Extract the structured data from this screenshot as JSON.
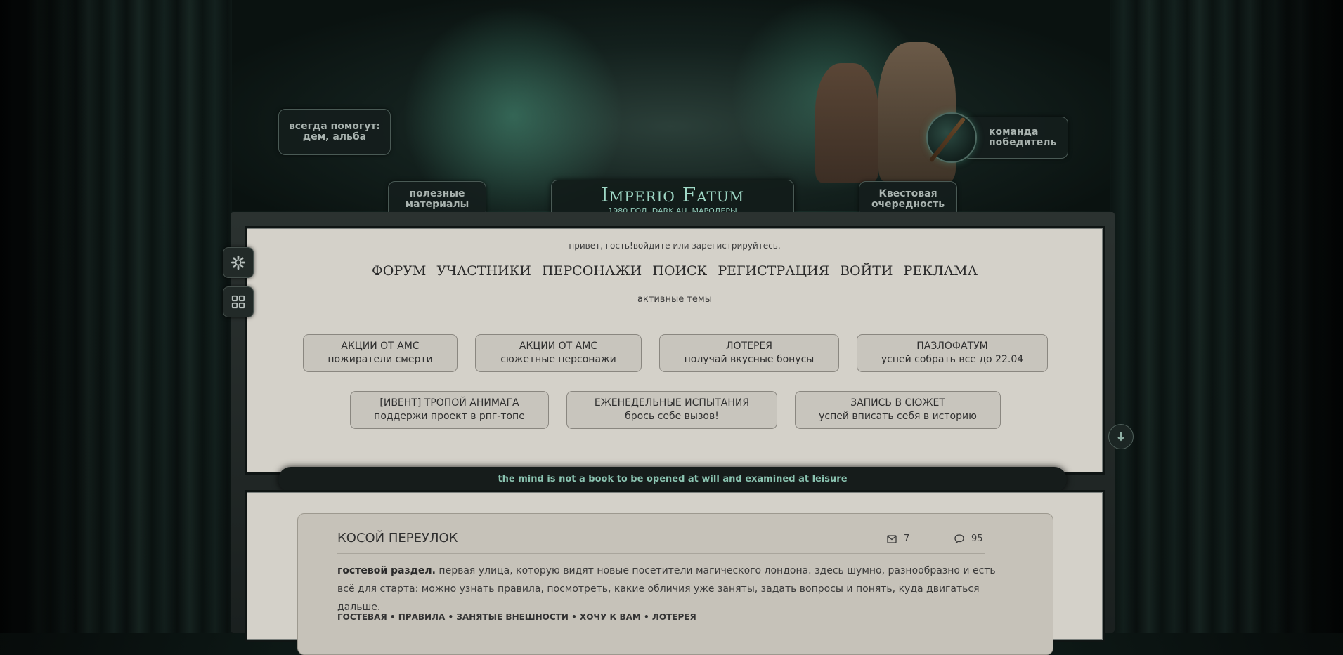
{
  "header": {
    "help_line1": "всегда помогут:",
    "help_line2": "дем, альба",
    "useful_line1": "полезные",
    "useful_line2": "материалы",
    "quest_line1": "Квестовая",
    "quest_line2": "очередность",
    "team_line1": "команда",
    "team_line2": "победитель",
    "logo_title": "Imperio Fatum",
    "logo_subtitle": "1980 ГОД, DARK AU, МАРОДЕРЫ"
  },
  "greeting": {
    "text": "привет, гость!",
    "login_link": "войдите",
    "or": " или ",
    "register_link": "зарегистрируйтесь",
    "end": "."
  },
  "nav": [
    "ФОРУМ",
    "УЧАСТНИКИ",
    "ПЕРСОНАЖИ",
    "ПОИСК",
    "РЕГИСТРАЦИЯ",
    "ВОЙТИ",
    "РЕКЛАМА"
  ],
  "active_topics_label": "активные темы",
  "topics_row1": [
    {
      "title": "АКЦИИ ОТ АМС",
      "subtitle": "пожиратели смерти"
    },
    {
      "title": "АКЦИИ ОТ АМС",
      "subtitle": "сюжетные персонажи"
    },
    {
      "title": "ЛОТЕРЕЯ",
      "subtitle": "получай вкусные бонусы"
    },
    {
      "title": "ПАЗЛОФАТУМ",
      "subtitle": "успей собрать все до 22.04"
    }
  ],
  "topics_row2": [
    {
      "title": "[ИВЕНТ] ТРОПОЙ АНИМАГА",
      "subtitle": "поддержи проект в рпг-топе"
    },
    {
      "title": "ЕЖЕНЕДЕЛЬНЫЕ ИСПЫТАНИЯ",
      "subtitle": "брось себе вызов!"
    },
    {
      "title": "ЗАПИСЬ В СЮЖЕТ",
      "subtitle": "успей вписать себя в историю"
    }
  ],
  "quote": "the mind is not a book to be opened at will and examined at leisure",
  "forum": {
    "title": "КОСОЙ ПЕРЕУЛОК",
    "topics_count": "7",
    "posts_count": "95",
    "desc_bold": "гостевой раздел.",
    "desc_text": " первая улица, которую видят новые посетители магического лондона. здесь шумно, разнообразно и есть всё для старта: можно узнать правила, посмотреть, какие обличия уже заняты, задать вопросы и понять, куда двигаться дальше.",
    "links": "ГОСТЕВАЯ • ПРАВИЛА • ЗАНЯТЫЕ ВНЕШНОСТИ • ХОЧУ К ВАМ • ЛОТЕРЕЯ"
  },
  "icons": {
    "settings": "gear-icon",
    "layout": "grid-icon",
    "scroll": "arrow-down-icon",
    "topics": "envelope-icon",
    "posts": "chat-bubble-icon"
  },
  "colors": {
    "accent": "#9fd8c6",
    "panel_bg": "#d4d1c9",
    "quote_text": "#8ac3b0"
  }
}
